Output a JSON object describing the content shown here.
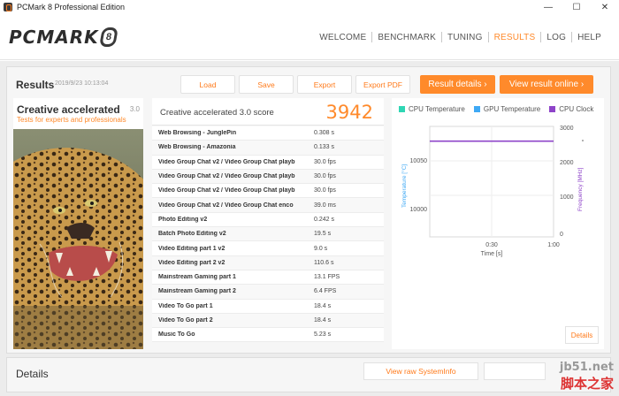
{
  "window": {
    "title": "PCMark 8 Professional Edition",
    "minimize": "—",
    "maximize": "☐",
    "close": "✕"
  },
  "logo": {
    "text": "PCMARK",
    "badge": "8"
  },
  "nav": [
    "WELCOME",
    "BENCHMARK",
    "TUNING",
    "RESULTS",
    "LOG",
    "HELP"
  ],
  "nav_active": "RESULTS",
  "results": {
    "title": "Results",
    "date": "2019/9/23 10:13:04",
    "buttons": {
      "load": "Load",
      "save": "Save",
      "export": "Export",
      "export_pdf": "Export PDF",
      "result_details": "Result details  ›",
      "view_online": "View result online  ›"
    }
  },
  "test": {
    "name": "Creative accelerated",
    "version": "3.0",
    "subtitle": "Tests for experts and professionals"
  },
  "score": {
    "label": "Creative accelerated 3.0 score",
    "value": "3942"
  },
  "rows": [
    {
      "name": "Web Browsing - JunglePin",
      "value": "0.308 s"
    },
    {
      "name": "Web Browsing - Amazonia",
      "value": "0.133 s"
    },
    {
      "name": "Video Group Chat v2 / Video Group Chat playb",
      "value": "30.0 fps"
    },
    {
      "name": "Video Group Chat v2 / Video Group Chat playb",
      "value": "30.0 fps"
    },
    {
      "name": "Video Group Chat v2 / Video Group Chat playb",
      "value": "30.0 fps"
    },
    {
      "name": "Video Group Chat v2 / Video Group Chat enco",
      "value": "39.0 ms"
    },
    {
      "name": "Photo Editing v2",
      "value": "0.242 s"
    },
    {
      "name": "Batch Photo Editing v2",
      "value": "19.5 s"
    },
    {
      "name": "Video Editing part 1 v2",
      "value": "9.0 s"
    },
    {
      "name": "Video Editing part 2 v2",
      "value": "110.6 s"
    },
    {
      "name": "Mainstream Gaming part 1",
      "value": "13.1 FPS"
    },
    {
      "name": "Mainstream Gaming part 2",
      "value": "6.4 FPS"
    },
    {
      "name": "Video To Go part 1",
      "value": "18.4 s"
    },
    {
      "name": "Video To Go part 2",
      "value": "18.4 s"
    },
    {
      "name": "Music To Go",
      "value": "5.23 s"
    }
  ],
  "chart": {
    "legend": [
      {
        "label": "CPU Temperature",
        "color": "#2fd6b4"
      },
      {
        "label": "GPU Temperature",
        "color": "#3fa9f5"
      },
      {
        "label": "CPU Clock",
        "color": "#8e44c9"
      }
    ],
    "ylabel_left": "Temperature [°C]",
    "ylabel_right": "Frequency [MHz]",
    "xlabel": "Time [s]",
    "left_ticks": [
      "10050",
      "10000"
    ],
    "right_ticks": [
      "3000",
      "2000",
      "1000",
      "0"
    ],
    "x_ticks": [
      "0:30",
      "1:00"
    ],
    "cpu_clock_mhz": 2600,
    "details": "Details"
  },
  "details": {
    "title": "Details",
    "view_raw": "View raw SystemInfo"
  },
  "watermark": {
    "top": "jb51.net",
    "bottom": "脚本之家"
  }
}
